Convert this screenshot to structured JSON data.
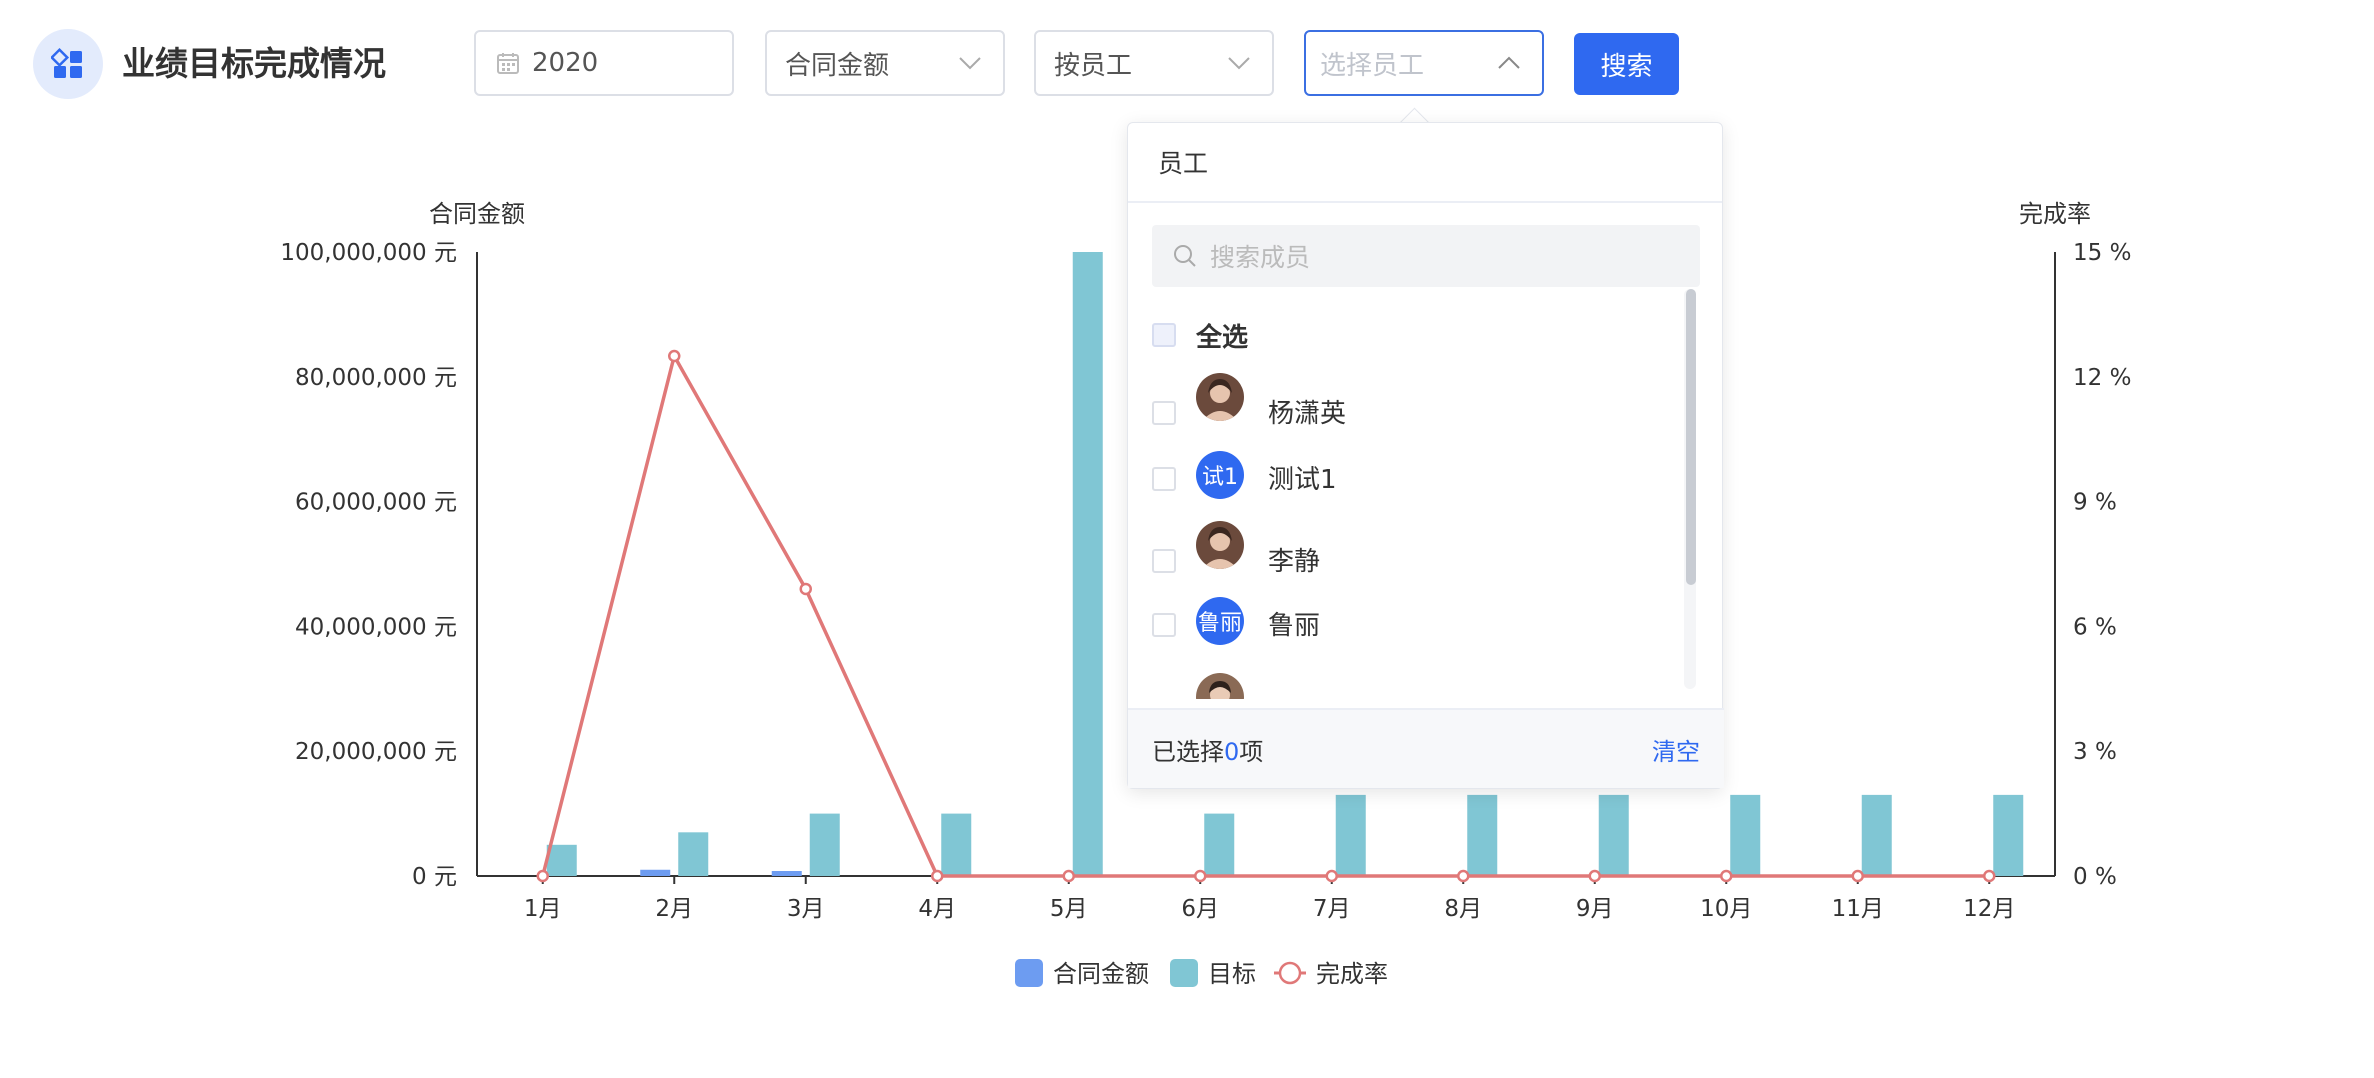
{
  "header": {
    "title": "业绩目标完成情况",
    "year": "2020",
    "metric": "合同金额",
    "group_by": "按员工",
    "employee_placeholder": "选择员工",
    "search_label": "搜索"
  },
  "employee_dropdown": {
    "header": "员工",
    "search_placeholder": "搜索成员",
    "select_all": "全选",
    "members": [
      {
        "name": "杨潇英",
        "avatar": "photo"
      },
      {
        "name": "测试1",
        "avatar": "text",
        "avatar_text": "试1"
      },
      {
        "name": "李静",
        "avatar": "photo"
      },
      {
        "name": "鲁丽",
        "avatar": "text",
        "avatar_text": "鲁丽"
      }
    ],
    "footer": {
      "selected_prefix": "已选择",
      "selected_count": "0",
      "selected_suffix": "项",
      "clear_label": "清空"
    }
  },
  "colors": {
    "accent": "#2f69f0",
    "contract": "#6d9cf1",
    "target": "#80c6d4",
    "rate": "#e07878"
  },
  "chart_data": {
    "type": "bar",
    "categories": [
      "1月",
      "2月",
      "3月",
      "4月",
      "5月",
      "6月",
      "7月",
      "8月",
      "9月",
      "10月",
      "11月",
      "12月"
    ],
    "series": [
      {
        "name": "合同金额",
        "type": "bar",
        "axis": "left",
        "values": [
          0,
          1000000,
          800000,
          0,
          0,
          0,
          0,
          0,
          0,
          0,
          0,
          0
        ]
      },
      {
        "name": "目标",
        "type": "bar",
        "axis": "left",
        "values": [
          5000000,
          7000000,
          10000000,
          10000000,
          100000000,
          10000000,
          13000000,
          13000000,
          13000000,
          13000000,
          13000000,
          13000000
        ]
      },
      {
        "name": "完成率",
        "type": "line",
        "axis": "right",
        "values": [
          0,
          12.5,
          6.9,
          0,
          0,
          0,
          0,
          0,
          0,
          0,
          0,
          0
        ]
      }
    ],
    "left_axis": {
      "label": "合同金额",
      "ylim": [
        0,
        100000000
      ],
      "ticks": [
        "0 元",
        "20,000,000 元",
        "40,000,000 元",
        "60,000,000 元",
        "80,000,000 元",
        "100,000,000 元"
      ]
    },
    "right_axis": {
      "label": "完成率",
      "ylim": [
        0,
        15
      ],
      "ticks": [
        "0 %",
        "3 %",
        "6 %",
        "9 %",
        "12 %",
        "15 %"
      ]
    },
    "legend": {
      "position": "bottom",
      "items": [
        "合同金额",
        "目标",
        "完成率"
      ]
    },
    "grid": false
  }
}
